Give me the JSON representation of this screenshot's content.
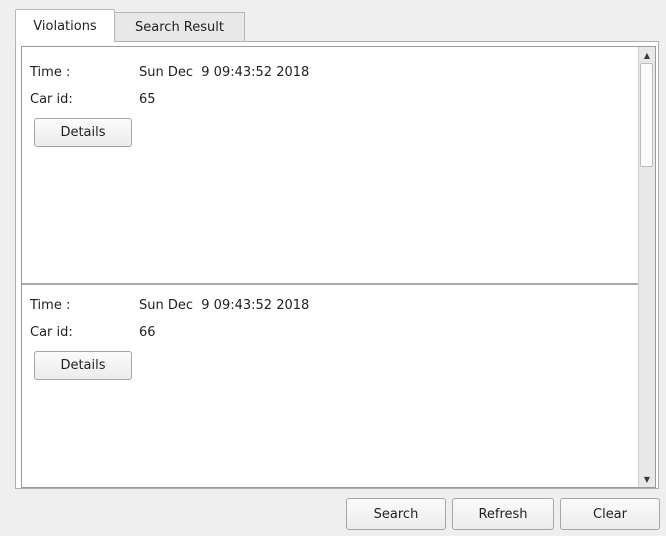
{
  "tabs": [
    {
      "label": "Violations",
      "active": true
    },
    {
      "label": "Search Result",
      "active": false
    }
  ],
  "records": [
    {
      "time_label": "Time :",
      "time_value": "Sun Dec  9 09:43:52 2018",
      "car_label": "Car id:",
      "car_value": "65",
      "details_label": "Details"
    },
    {
      "time_label": "Time :",
      "time_value": "Sun Dec  9 09:43:52 2018",
      "car_label": "Car id:",
      "car_value": "66",
      "details_label": "Details"
    }
  ],
  "scrollbar": {
    "up_icon": "arrow-up",
    "down_icon": "arrow-down"
  },
  "buttons": {
    "search": "Search",
    "refresh": "Refresh",
    "clear": "Clear"
  }
}
